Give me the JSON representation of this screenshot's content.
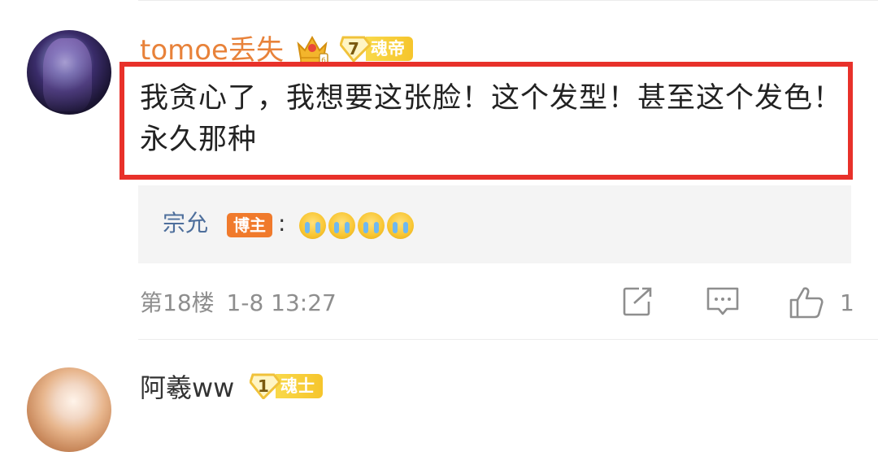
{
  "comment": {
    "username": "tomoe丢失",
    "level": "7",
    "rank": "魂帝",
    "text": "我贪心了，我想要这张脸！这个发型！甚至这个发色！永久那种",
    "reply": {
      "name": "宗允",
      "badge": "博主",
      "separator": ":",
      "emojis": [
        "crying-emoji",
        "crying-emoji",
        "crying-emoji",
        "crying-emoji"
      ]
    },
    "floor": "第18楼",
    "timestamp": "1-8 13:27",
    "like_count": "1",
    "actions": [
      "share-icon",
      "comment-icon",
      "like-icon"
    ]
  },
  "next_comment": {
    "username": "阿羲ww",
    "level": "1",
    "rank": "魂士"
  },
  "colors": {
    "username_vip": "#e8823a",
    "highlight_border": "#e8312a",
    "reply_name": "#4e6f9c",
    "host_badge": "#f07a2c",
    "rank_badge": "#f6c52c"
  }
}
